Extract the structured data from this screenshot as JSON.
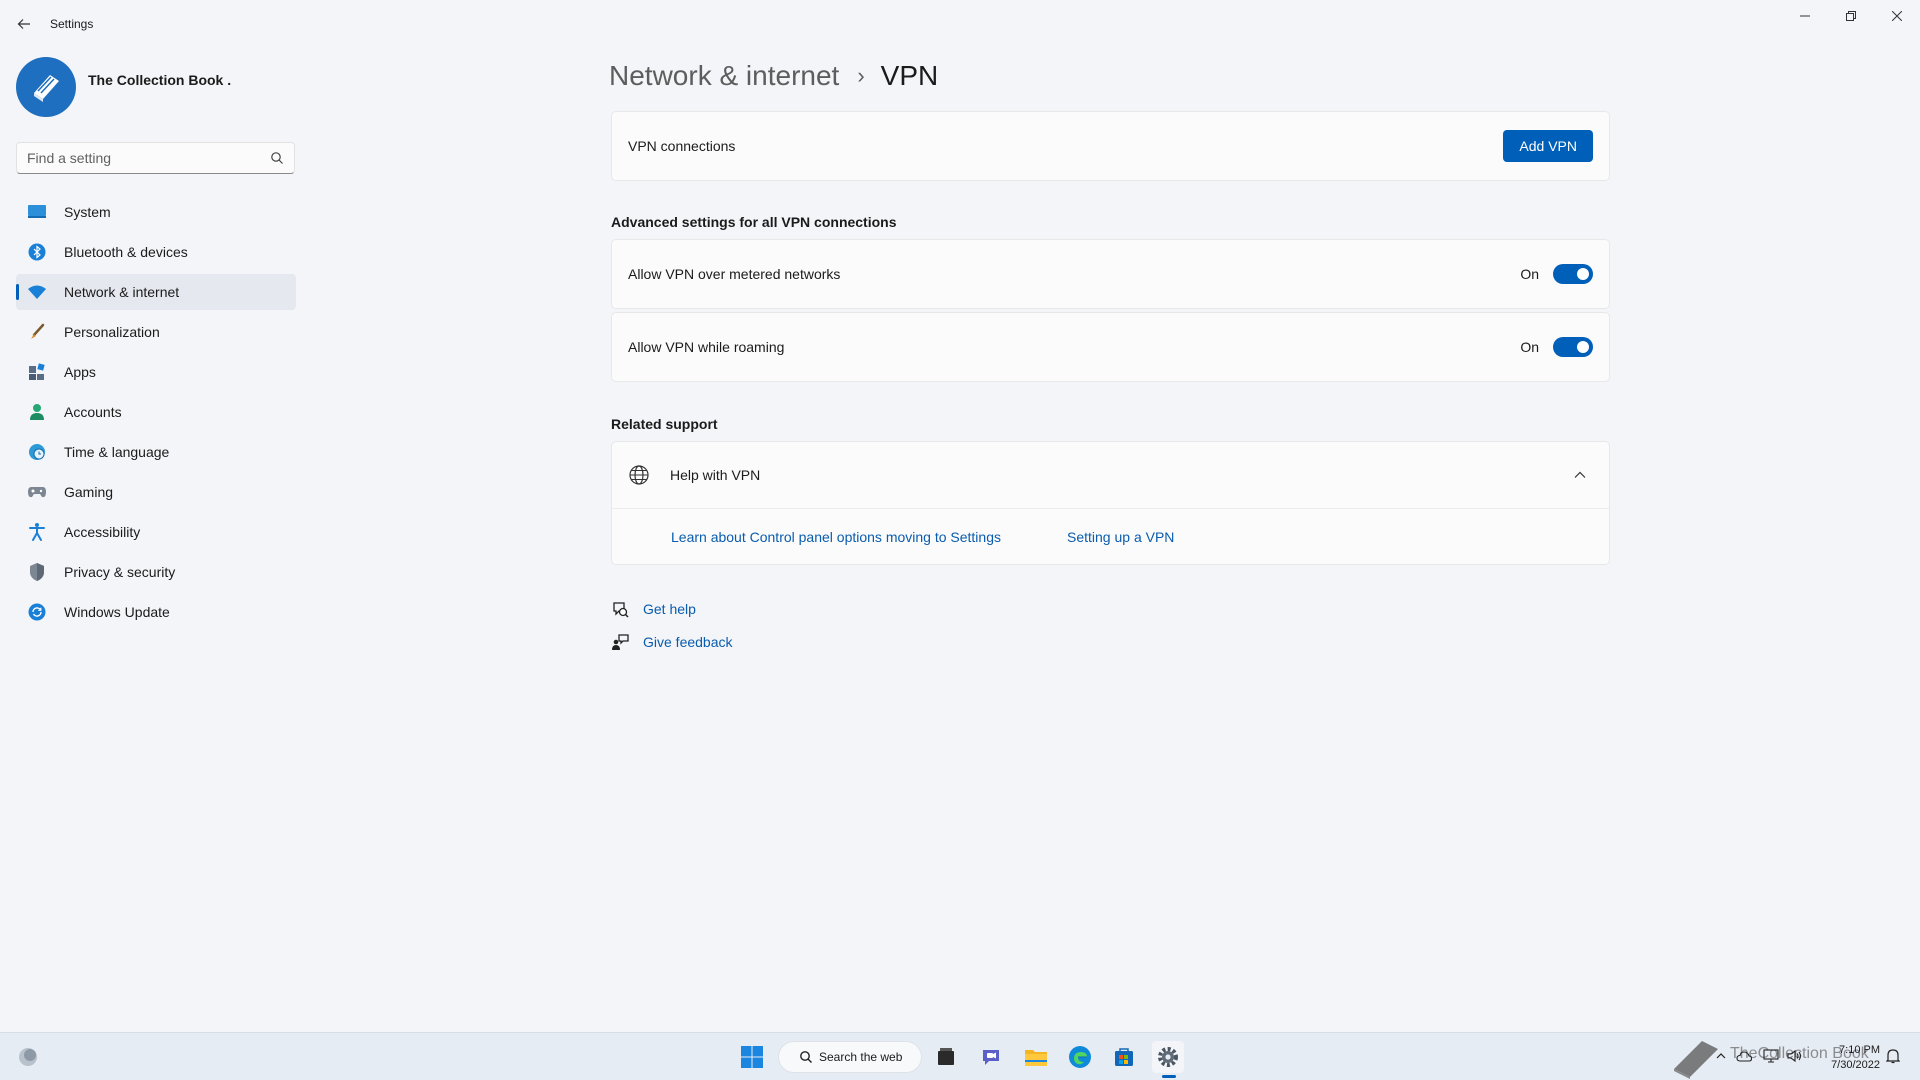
{
  "window": {
    "title": "Settings"
  },
  "profile": {
    "name": "The Collection Book ."
  },
  "search": {
    "placeholder": "Find a setting"
  },
  "sidebar": {
    "items": [
      {
        "label": "System",
        "icon": "monitor-icon"
      },
      {
        "label": "Bluetooth & devices",
        "icon": "bluetooth-icon"
      },
      {
        "label": "Network & internet",
        "icon": "wifi-icon",
        "active": true
      },
      {
        "label": "Personalization",
        "icon": "brush-icon"
      },
      {
        "label": "Apps",
        "icon": "apps-icon"
      },
      {
        "label": "Accounts",
        "icon": "person-icon"
      },
      {
        "label": "Time & language",
        "icon": "globe-clock-icon"
      },
      {
        "label": "Gaming",
        "icon": "gamepad-icon"
      },
      {
        "label": "Accessibility",
        "icon": "accessibility-icon"
      },
      {
        "label": "Privacy & security",
        "icon": "shield-icon"
      },
      {
        "label": "Windows Update",
        "icon": "update-icon"
      }
    ]
  },
  "breadcrumb": {
    "parent": "Network & internet",
    "separator": "›",
    "current": "VPN"
  },
  "vpn": {
    "connections_label": "VPN connections",
    "add_button": "Add VPN"
  },
  "advanced": {
    "title": "Advanced settings for all VPN connections",
    "metered": {
      "label": "Allow VPN over metered networks",
      "state": "On",
      "enabled": true
    },
    "roaming": {
      "label": "Allow VPN while roaming",
      "state": "On",
      "enabled": true
    }
  },
  "related": {
    "title": "Related support",
    "help_title": "Help with VPN",
    "expanded": true,
    "links": [
      "Learn about Control panel options moving to Settings",
      "Setting up a VPN"
    ]
  },
  "footer": {
    "get_help": "Get help",
    "give_feedback": "Give feedback"
  },
  "taskbar": {
    "search_label": "Search the web",
    "time": "7:10 PM",
    "date": "7/30/2022",
    "watermark": "TheCollection Book"
  },
  "colors": {
    "accent": "#005fb8",
    "link": "#0a5cad",
    "background": "#f3f5f9"
  }
}
